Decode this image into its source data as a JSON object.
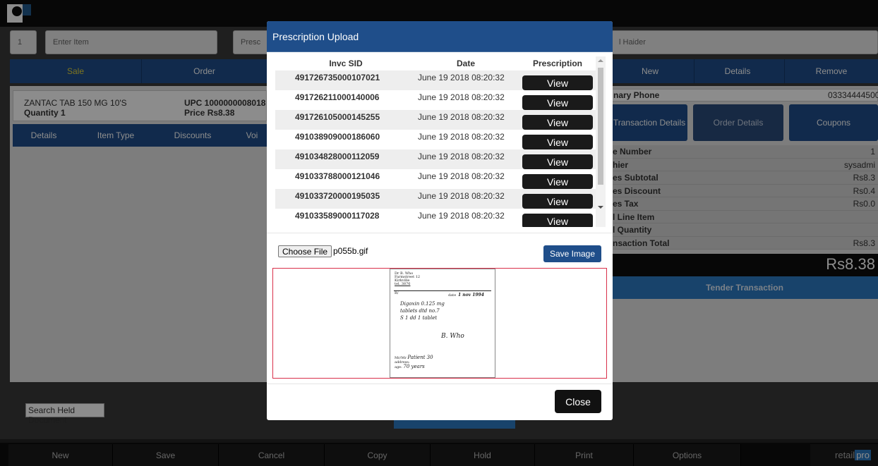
{
  "app": {
    "item_input_number": "1",
    "item_input_placeholder": "Enter Item",
    "prescription_field_partial": "Presc",
    "customer_name_partial": "l Haider",
    "tabs": [
      "Sale",
      "Order"
    ],
    "right_tabs": [
      "New",
      "Details",
      "Remove"
    ],
    "item": {
      "name": "ZANTAC TAB 150 MG 10'S",
      "qty_label": "Quantity 1",
      "upc": "UPC 1000000008018",
      "price": "Price Rs8.38"
    },
    "subtabs": [
      "Details",
      "Item Type",
      "Discounts",
      "Voi"
    ],
    "primary_phone_label": "nary Phone",
    "primary_phone_value": "03334444500",
    "action_buttons": [
      "Transaction Details",
      "Order Details",
      "Coupons"
    ],
    "summary": [
      {
        "label": "e Number",
        "value": "1"
      },
      {
        "label": "hier",
        "value": "sysadmi"
      },
      {
        "label": "es Subtotal",
        "value": "Rs8.3"
      },
      {
        "label": "es Discount",
        "value": "Rs0.4"
      },
      {
        "label": "es Tax",
        "value": "Rs0.0"
      },
      {
        "label": "l Line Item",
        "value": ""
      },
      {
        "label": "l Quantity",
        "value": ""
      },
      {
        "label": "nsaction Total",
        "value": "Rs8.3"
      }
    ],
    "grand_total": "Rs8.38",
    "tender_label": "Tender Transaction",
    "search_held_placeholder": "Search Held Document",
    "bottom_buttons": [
      "New",
      "Save",
      "Cancel",
      "Copy",
      "Hold",
      "Print",
      "Options"
    ],
    "brand_retail": "retail",
    "brand_pro": "pro"
  },
  "modal": {
    "title": "Prescription Upload",
    "columns": [
      "Invc SID",
      "Date",
      "Prescription"
    ],
    "rows": [
      {
        "sid": "491726735000107021",
        "date": "June 19 2018 08:20:32",
        "action": "View"
      },
      {
        "sid": "491726211000140006",
        "date": "June 19 2018 08:20:32",
        "action": "View"
      },
      {
        "sid": "491726105000145255",
        "date": "June 19 2018 08:20:32",
        "action": "View"
      },
      {
        "sid": "491038909000186060",
        "date": "June 19 2018 08:20:32",
        "action": "View"
      },
      {
        "sid": "491034828000112059",
        "date": "June 19 2018 08:20:32",
        "action": "View"
      },
      {
        "sid": "491033788000121046",
        "date": "June 19 2018 08:20:32",
        "action": "View"
      },
      {
        "sid": "491033720000195035",
        "date": "June 19 2018 08:20:32",
        "action": "View"
      },
      {
        "sid": "491033589000117028",
        "date": "June 19 2018 08:20:32",
        "action": "View"
      }
    ],
    "choose_file_label": "Choose File",
    "file_name": "p055b.gif",
    "save_image_label": "Save Image",
    "close_label": "Close",
    "prescription_image": {
      "doctor": "Dr B. Who",
      "street": "Farmstreet 12",
      "city": "Kirkville",
      "tel": "tel. 3876",
      "rx": "R/",
      "date_label": "date",
      "date_value": "1 nov 1994",
      "line1": "Digoxin 0.125 mg",
      "line2": "tablets dtd no.7",
      "line3": "S 1 dd 1 tablet",
      "signature": "B. Who",
      "patient_label": "Mr/Mr",
      "patient_value": "Patient 30",
      "address_label": "address:",
      "age_label": "age:",
      "age_value": "70 years"
    }
  }
}
